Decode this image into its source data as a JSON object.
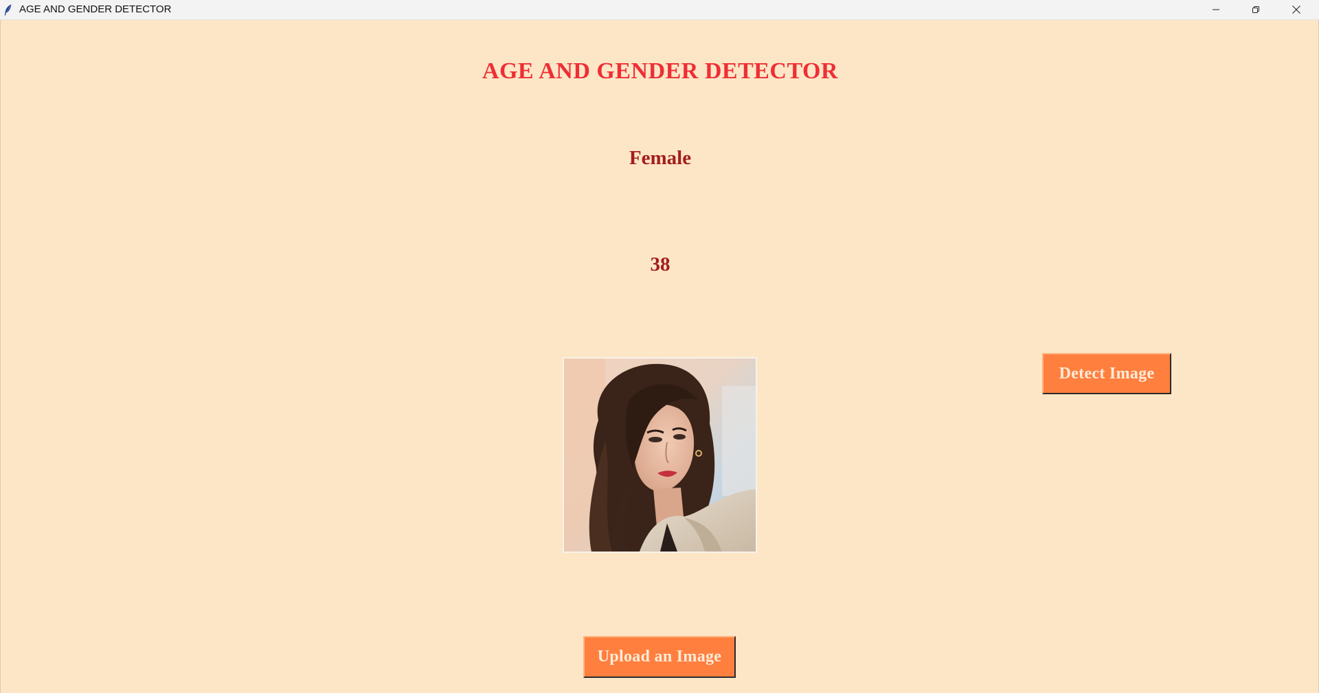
{
  "window": {
    "title": "AGE AND GENDER DETECTOR",
    "controls": {
      "minimize": "minimize-icon",
      "maximize": "restore-icon",
      "close": "close-icon"
    }
  },
  "app": {
    "heading": "AGE AND GENDER DETECTOR",
    "gender_result": "Female",
    "age_result": "38",
    "detect_button": "Detect Image",
    "upload_button": "Upload an Image"
  },
  "colors": {
    "background": "#fde6c6",
    "heading": "#ef2e35",
    "result_text": "#a31d1d",
    "button": "#ff7f3f",
    "button_text": "#fdecd8"
  }
}
